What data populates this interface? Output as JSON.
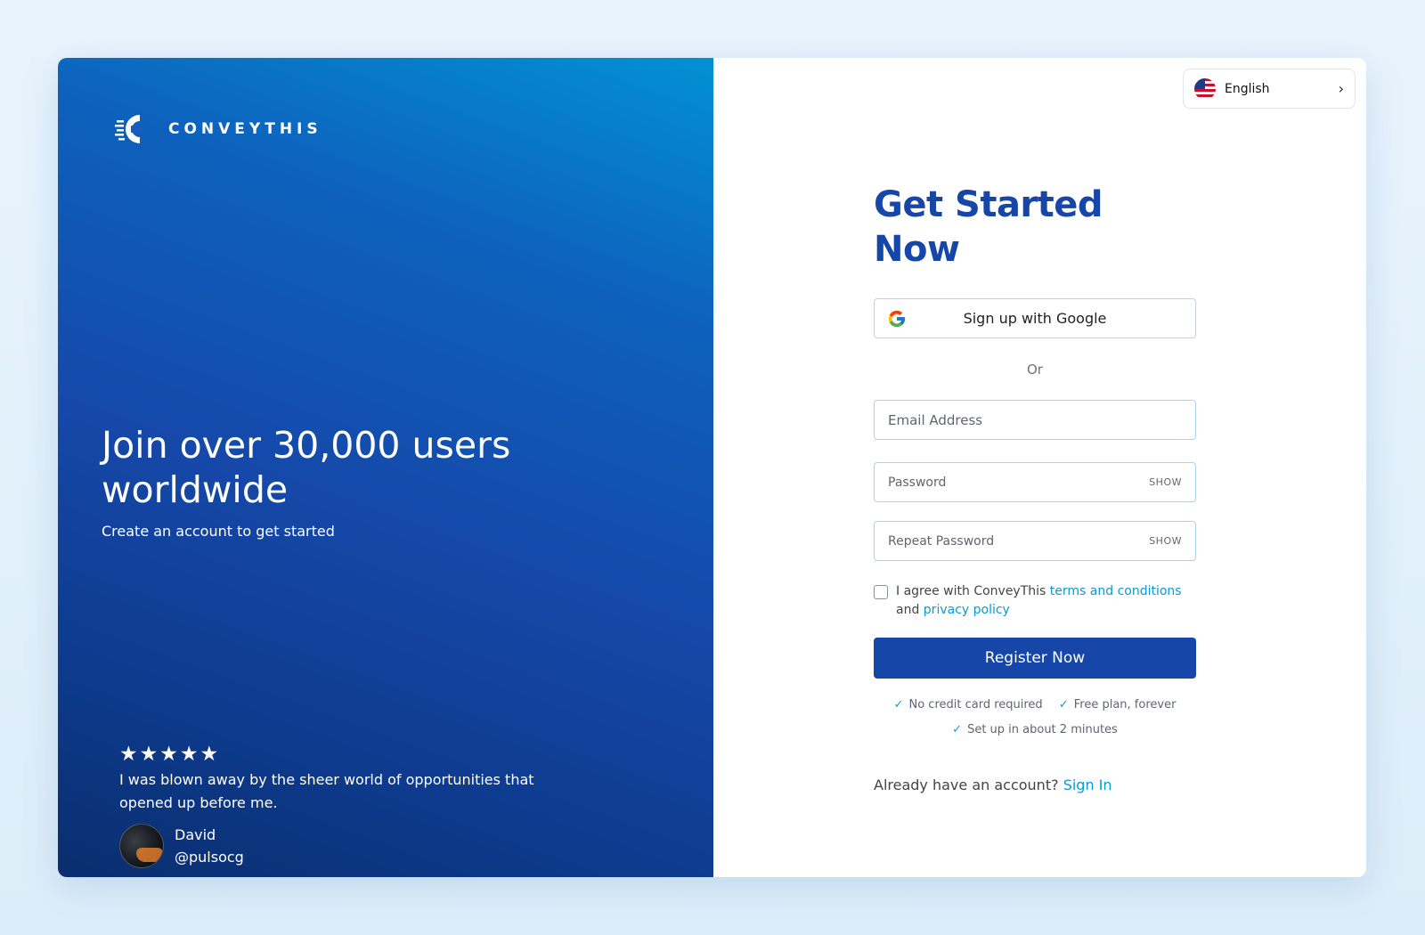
{
  "brand": {
    "name": "CONVEYTHIS"
  },
  "hero": {
    "title": "Join over 30,000 users worldwide",
    "subtitle": "Create an account to get started"
  },
  "review": {
    "stars": "★★★★★",
    "rating": 5,
    "quote": "I was blown away by the sheer world of opportunities that opened up before me.",
    "author_name": "David",
    "author_handle": "@pulsocg"
  },
  "language": {
    "label": "English",
    "chevron": "›"
  },
  "form": {
    "title": "Get Started Now",
    "google_label": "Sign up with Google",
    "or_label": "Or",
    "email_placeholder": "Email Address",
    "password_placeholder": "Password",
    "repeat_password_placeholder": "Repeat Password",
    "show_label": "SHOW",
    "agree_prefix": "I agree with ConveyThis",
    "terms_link": "terms and conditions",
    "and_text": "and",
    "privacy_link": "privacy policy",
    "register_label": "Register Now",
    "perks": [
      "No credit card required",
      "Free plan, forever",
      "Set up in about 2 minutes"
    ],
    "check_glyph": "✓",
    "signin_prompt": "Already have an account?",
    "signin_link": "Sign In"
  },
  "colors": {
    "primary": "#1546a8",
    "link": "#0a9ad4",
    "field_border": "#a9d3f0"
  },
  "icons": {
    "logo": "conveythis-logo-icon",
    "flag": "us-flag-icon",
    "google": "google-icon",
    "chevron": "chevron-right-icon",
    "check": "check-icon",
    "star": "star-icon"
  }
}
